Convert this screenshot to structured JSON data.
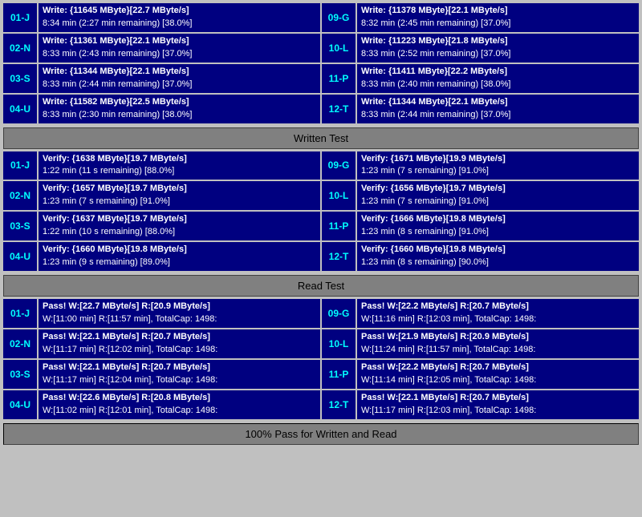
{
  "sections": {
    "written_test_label": "Written Test",
    "read_test_label": "Read Test",
    "pass_footer": "100% Pass for Written and Read"
  },
  "write_rows": [
    {
      "left": {
        "id": "01-J",
        "line1": "Write: {11645 MByte}[22.7 MByte/s]",
        "line2": "8:34 min (2:27 min remaining)  [38.0%]"
      },
      "right": {
        "id": "09-G",
        "line1": "Write: {11378 MByte}[22.1 MByte/s]",
        "line2": "8:32 min (2:45 min remaining)  [37.0%]"
      }
    },
    {
      "left": {
        "id": "02-N",
        "line1": "Write: {11361 MByte}[22.1 MByte/s]",
        "line2": "8:33 min (2:43 min remaining)  [37.0%]"
      },
      "right": {
        "id": "10-L",
        "line1": "Write: {11223 MByte}[21.8 MByte/s]",
        "line2": "8:33 min (2:52 min remaining)  [37.0%]"
      }
    },
    {
      "left": {
        "id": "03-S",
        "line1": "Write: {11344 MByte}[22.1 MByte/s]",
        "line2": "8:33 min (2:44 min remaining)  [37.0%]"
      },
      "right": {
        "id": "11-P",
        "line1": "Write: {11411 MByte}[22.2 MByte/s]",
        "line2": "8:33 min (2:40 min remaining)  [38.0%]"
      }
    },
    {
      "left": {
        "id": "04-U",
        "line1": "Write: {11582 MByte}[22.5 MByte/s]",
        "line2": "8:33 min (2:30 min remaining)  [38.0%]"
      },
      "right": {
        "id": "12-T",
        "line1": "Write: {11344 MByte}[22.1 MByte/s]",
        "line2": "8:33 min (2:44 min remaining)  [37.0%]"
      }
    }
  ],
  "verify_rows": [
    {
      "left": {
        "id": "01-J",
        "line1": "Verify: {1638 MByte}[19.7 MByte/s]",
        "line2": "1:22 min (11 s remaining)   [88.0%]"
      },
      "right": {
        "id": "09-G",
        "line1": "Verify: {1671 MByte}[19.9 MByte/s]",
        "line2": "1:23 min (7 s remaining)   [91.0%]"
      }
    },
    {
      "left": {
        "id": "02-N",
        "line1": "Verify: {1657 MByte}[19.7 MByte/s]",
        "line2": "1:23 min (7 s remaining)   [91.0%]"
      },
      "right": {
        "id": "10-L",
        "line1": "Verify: {1656 MByte}[19.7 MByte/s]",
        "line2": "1:23 min (7 s remaining)   [91.0%]"
      }
    },
    {
      "left": {
        "id": "03-S",
        "line1": "Verify: {1637 MByte}[19.7 MByte/s]",
        "line2": "1:22 min (10 s remaining)   [88.0%]"
      },
      "right": {
        "id": "11-P",
        "line1": "Verify: {1666 MByte}[19.8 MByte/s]",
        "line2": "1:23 min (8 s remaining)   [91.0%]"
      }
    },
    {
      "left": {
        "id": "04-U",
        "line1": "Verify: {1660 MByte}[19.8 MByte/s]",
        "line2": "1:23 min (9 s remaining)   [89.0%]"
      },
      "right": {
        "id": "12-T",
        "line1": "Verify: {1660 MByte}[19.8 MByte/s]",
        "line2": "1:23 min (8 s remaining)   [90.0%]"
      }
    }
  ],
  "pass_rows": [
    {
      "left": {
        "id": "01-J",
        "line1": "Pass! W:[22.7 MByte/s] R:[20.9 MByte/s]",
        "line2": "W:[11:00 min] R:[11:57 min], TotalCap: 1498:"
      },
      "right": {
        "id": "09-G",
        "line1": "Pass! W:[22.2 MByte/s] R:[20.7 MByte/s]",
        "line2": "W:[11:16 min] R:[12:03 min], TotalCap: 1498:"
      }
    },
    {
      "left": {
        "id": "02-N",
        "line1": "Pass! W:[22.1 MByte/s] R:[20.7 MByte/s]",
        "line2": "W:[11:17 min] R:[12:02 min], TotalCap: 1498:"
      },
      "right": {
        "id": "10-L",
        "line1": "Pass! W:[21.9 MByte/s] R:[20.9 MByte/s]",
        "line2": "W:[11:24 min] R:[11:57 min], TotalCap: 1498:"
      }
    },
    {
      "left": {
        "id": "03-S",
        "line1": "Pass! W:[22.1 MByte/s] R:[20.7 MByte/s]",
        "line2": "W:[11:17 min] R:[12:04 min], TotalCap: 1498:"
      },
      "right": {
        "id": "11-P",
        "line1": "Pass! W:[22.2 MByte/s] R:[20.7 MByte/s]",
        "line2": "W:[11:14 min] R:[12:05 min], TotalCap: 1498:"
      }
    },
    {
      "left": {
        "id": "04-U",
        "line1": "Pass! W:[22.6 MByte/s] R:[20.8 MByte/s]",
        "line2": "W:[11:02 min] R:[12:01 min], TotalCap: 1498:"
      },
      "right": {
        "id": "12-T",
        "line1": "Pass! W:[22.1 MByte/s] R:[20.7 MByte/s]",
        "line2": "W:[11:17 min] R:[12:03 min], TotalCap: 1498:"
      }
    }
  ]
}
